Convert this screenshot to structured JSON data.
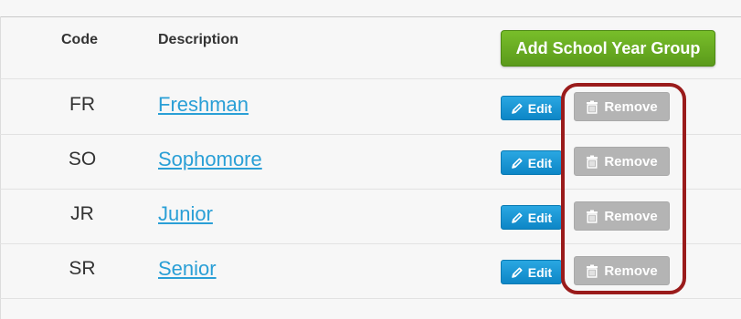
{
  "header": {
    "code_label": "Code",
    "description_label": "Description",
    "add_button_label": "Add School Year Group"
  },
  "rows": [
    {
      "code": "FR",
      "description": "Freshman",
      "edit_label": "Edit",
      "remove_label": "Remove"
    },
    {
      "code": "SO",
      "description": "Sophomore",
      "edit_label": "Edit",
      "remove_label": "Remove"
    },
    {
      "code": "JR",
      "description": "Junior",
      "edit_label": "Edit",
      "remove_label": "Remove"
    },
    {
      "code": "SR",
      "description": "Senior",
      "edit_label": "Edit",
      "remove_label": "Remove"
    }
  ],
  "icons": {
    "edit": "pencil-icon",
    "remove": "trash-icon"
  },
  "colors": {
    "add_button": "#6aae22",
    "edit_button": "#1c97d6",
    "remove_button": "#b4b4b4",
    "link": "#2a9fd6",
    "highlight": "#9a1b1b"
  }
}
